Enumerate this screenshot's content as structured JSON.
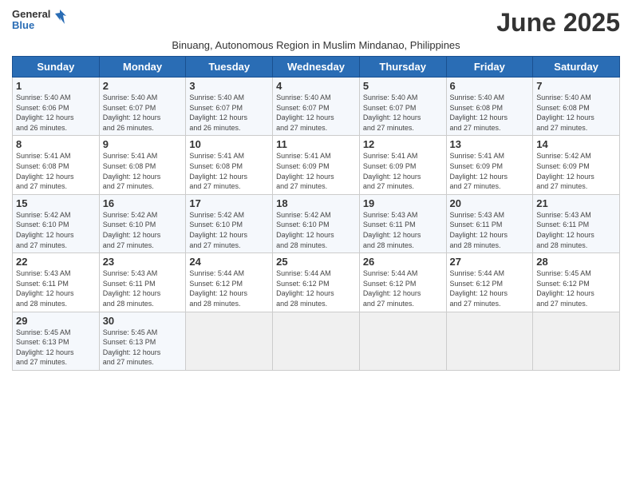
{
  "header": {
    "logo_general": "General",
    "logo_blue": "Blue",
    "month_title": "June 2025",
    "subtitle": "Binuang, Autonomous Region in Muslim Mindanao, Philippines"
  },
  "weekdays": [
    "Sunday",
    "Monday",
    "Tuesday",
    "Wednesday",
    "Thursday",
    "Friday",
    "Saturday"
  ],
  "weeks": [
    [
      {
        "day": "1",
        "info": "Sunrise: 5:40 AM\nSunset: 6:06 PM\nDaylight: 12 hours\nand 26 minutes."
      },
      {
        "day": "2",
        "info": "Sunrise: 5:40 AM\nSunset: 6:07 PM\nDaylight: 12 hours\nand 26 minutes."
      },
      {
        "day": "3",
        "info": "Sunrise: 5:40 AM\nSunset: 6:07 PM\nDaylight: 12 hours\nand 26 minutes."
      },
      {
        "day": "4",
        "info": "Sunrise: 5:40 AM\nSunset: 6:07 PM\nDaylight: 12 hours\nand 27 minutes."
      },
      {
        "day": "5",
        "info": "Sunrise: 5:40 AM\nSunset: 6:07 PM\nDaylight: 12 hours\nand 27 minutes."
      },
      {
        "day": "6",
        "info": "Sunrise: 5:40 AM\nSunset: 6:08 PM\nDaylight: 12 hours\nand 27 minutes."
      },
      {
        "day": "7",
        "info": "Sunrise: 5:40 AM\nSunset: 6:08 PM\nDaylight: 12 hours\nand 27 minutes."
      }
    ],
    [
      {
        "day": "8",
        "info": "Sunrise: 5:41 AM\nSunset: 6:08 PM\nDaylight: 12 hours\nand 27 minutes."
      },
      {
        "day": "9",
        "info": "Sunrise: 5:41 AM\nSunset: 6:08 PM\nDaylight: 12 hours\nand 27 minutes."
      },
      {
        "day": "10",
        "info": "Sunrise: 5:41 AM\nSunset: 6:08 PM\nDaylight: 12 hours\nand 27 minutes."
      },
      {
        "day": "11",
        "info": "Sunrise: 5:41 AM\nSunset: 6:09 PM\nDaylight: 12 hours\nand 27 minutes."
      },
      {
        "day": "12",
        "info": "Sunrise: 5:41 AM\nSunset: 6:09 PM\nDaylight: 12 hours\nand 27 minutes."
      },
      {
        "day": "13",
        "info": "Sunrise: 5:41 AM\nSunset: 6:09 PM\nDaylight: 12 hours\nand 27 minutes."
      },
      {
        "day": "14",
        "info": "Sunrise: 5:42 AM\nSunset: 6:09 PM\nDaylight: 12 hours\nand 27 minutes."
      }
    ],
    [
      {
        "day": "15",
        "info": "Sunrise: 5:42 AM\nSunset: 6:10 PM\nDaylight: 12 hours\nand 27 minutes."
      },
      {
        "day": "16",
        "info": "Sunrise: 5:42 AM\nSunset: 6:10 PM\nDaylight: 12 hours\nand 27 minutes."
      },
      {
        "day": "17",
        "info": "Sunrise: 5:42 AM\nSunset: 6:10 PM\nDaylight: 12 hours\nand 27 minutes."
      },
      {
        "day": "18",
        "info": "Sunrise: 5:42 AM\nSunset: 6:10 PM\nDaylight: 12 hours\nand 28 minutes."
      },
      {
        "day": "19",
        "info": "Sunrise: 5:43 AM\nSunset: 6:11 PM\nDaylight: 12 hours\nand 28 minutes."
      },
      {
        "day": "20",
        "info": "Sunrise: 5:43 AM\nSunset: 6:11 PM\nDaylight: 12 hours\nand 28 minutes."
      },
      {
        "day": "21",
        "info": "Sunrise: 5:43 AM\nSunset: 6:11 PM\nDaylight: 12 hours\nand 28 minutes."
      }
    ],
    [
      {
        "day": "22",
        "info": "Sunrise: 5:43 AM\nSunset: 6:11 PM\nDaylight: 12 hours\nand 28 minutes."
      },
      {
        "day": "23",
        "info": "Sunrise: 5:43 AM\nSunset: 6:11 PM\nDaylight: 12 hours\nand 28 minutes."
      },
      {
        "day": "24",
        "info": "Sunrise: 5:44 AM\nSunset: 6:12 PM\nDaylight: 12 hours\nand 28 minutes."
      },
      {
        "day": "25",
        "info": "Sunrise: 5:44 AM\nSunset: 6:12 PM\nDaylight: 12 hours\nand 28 minutes."
      },
      {
        "day": "26",
        "info": "Sunrise: 5:44 AM\nSunset: 6:12 PM\nDaylight: 12 hours\nand 27 minutes."
      },
      {
        "day": "27",
        "info": "Sunrise: 5:44 AM\nSunset: 6:12 PM\nDaylight: 12 hours\nand 27 minutes."
      },
      {
        "day": "28",
        "info": "Sunrise: 5:45 AM\nSunset: 6:12 PM\nDaylight: 12 hours\nand 27 minutes."
      }
    ],
    [
      {
        "day": "29",
        "info": "Sunrise: 5:45 AM\nSunset: 6:13 PM\nDaylight: 12 hours\nand 27 minutes."
      },
      {
        "day": "30",
        "info": "Sunrise: 5:45 AM\nSunset: 6:13 PM\nDaylight: 12 hours\nand 27 minutes."
      },
      {
        "day": "",
        "info": ""
      },
      {
        "day": "",
        "info": ""
      },
      {
        "day": "",
        "info": ""
      },
      {
        "day": "",
        "info": ""
      },
      {
        "day": "",
        "info": ""
      }
    ]
  ]
}
